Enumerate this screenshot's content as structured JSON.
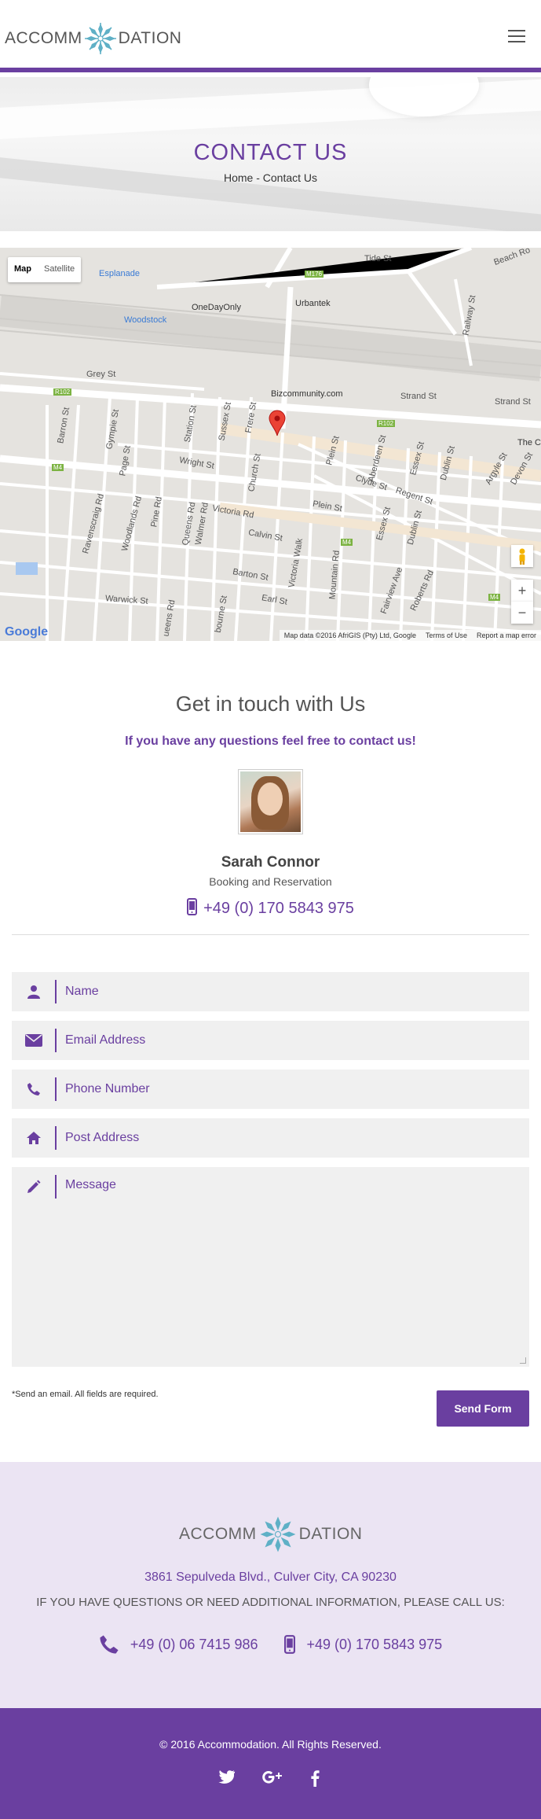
{
  "header": {
    "logo_left": "ACCOMM",
    "logo_right": "DATION"
  },
  "hero": {
    "title": "CONTACT US",
    "breadcrumb_home": "Home",
    "breadcrumb_sep": " - ",
    "breadcrumb_current": "Contact Us"
  },
  "map": {
    "toggle_map": "Map",
    "toggle_satellite": "Satellite",
    "zoom_in": "+",
    "zoom_out": "−",
    "footer_data": "Map data ©2016 AfriGIS (Pty) Ltd, Google",
    "footer_terms": "Terms of Use",
    "footer_report": "Report a map error",
    "google": "Google",
    "labels": {
      "tide_st": "Tide St",
      "beach_rd": "Beach Ro",
      "esplanade": "Esplanade",
      "m176": "M176",
      "urbantek": "Urbantek",
      "onedayonly": "OneDayOnly",
      "woodstock": "Woodstock",
      "railway_st": "Railway St",
      "grey_st": "Grey St",
      "bizcommunity": "Bizcommunity.com",
      "strand_st": "Strand St",
      "strand_st2": "Strand St",
      "r102a": "R102",
      "r102b": "R102",
      "the_c": "The C",
      "m4a": "M4",
      "m4b": "M4",
      "m4c": "M4",
      "wright_st": "Wright St",
      "victoria_rd": "Victoria Rd",
      "calvin_st": "Calvin St",
      "barton_st": "Barton St",
      "earl_st": "Earl St",
      "warwick_st": "Warwick St",
      "clyde_st": "Clyde St",
      "regent_st": "Regent St",
      "plein_st": "Plein St",
      "plein_st2": "Plein St",
      "argyle_st": "Argyle St",
      "devon_st": "Devon St",
      "dublin_st": "Dublin St",
      "dublin_st2": "Dublin St",
      "essex_st": "Essex St",
      "essex_st2": "Essex St",
      "aberdeen_st": "Aberdeen St",
      "roberts_rd": "Roberts Rd",
      "fairview_ave": "Fairview Ave",
      "mountain_rd": "Mountain Rd",
      "victoria_walk": "Victoria Walk",
      "church_st": "Church St",
      "frere_st": "Frere St",
      "sussex_st": "Sussex St",
      "station_st": "Station St",
      "gympie_st": "Gympie St",
      "page_st": "Page St",
      "barron_st": "Barron St",
      "ravenscraig_rd": "Ravenscraig Rd",
      "woodlands_rd": "Woodlands Rd",
      "pine_rd": "Pine Rd",
      "queens_rd": "Queens Rd",
      "walmer_rd": "Walmer Rd",
      "osbourne_st": "bourne St",
      "ueens_rd": "ueens Rd"
    }
  },
  "contact": {
    "title": "Get in touch with Us",
    "subtitle": "If you have any questions feel free to contact us!",
    "person_name": "Sarah Connor",
    "person_role": "Booking and Reservation",
    "person_phone": "+49 (0) 170 5843 975"
  },
  "form": {
    "name_placeholder": "Name",
    "email_placeholder": "Email Address",
    "phone_placeholder": "Phone Number",
    "address_placeholder": "Post Address",
    "message_placeholder": "Message",
    "note": "*Send an email. All fields are required.",
    "submit_label": "Send Form"
  },
  "footer": {
    "logo_left": "ACCOMM",
    "logo_right": "DATION",
    "address": "3861 Sepulveda Blvd., Culver City, CA 90230",
    "question": "IF YOU HAVE QUESTIONS OR NEED ADDITIONAL INFORMATION, PLEASE CALL US:",
    "phone_landline": "+49 (0) 06 7415 986",
    "phone_mobile": "+49 (0) 170 5843 975",
    "copyright": "© 2016 Accommodation. All Rights Reserved.",
    "social_twitter": "twitter-icon",
    "social_gplus": "google-plus-icon",
    "social_facebook": "facebook-icon"
  },
  "colors": {
    "accent": "#6a3fa0",
    "footer_bg": "#ebe4f3",
    "field_bg": "#f0f0f0"
  }
}
